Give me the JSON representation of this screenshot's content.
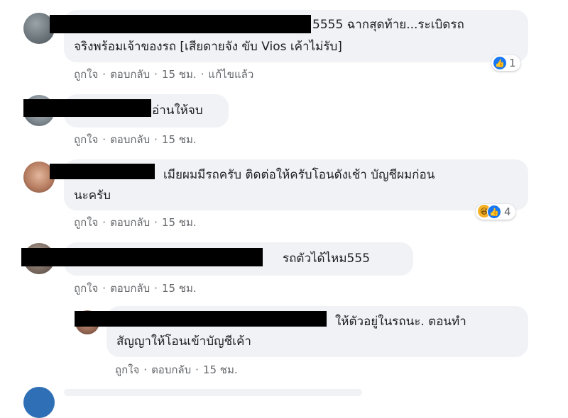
{
  "comments": [
    {
      "line1": "5555 ฉากสุดท้าย...ระเบิดรถ",
      "line2": "จริงพร้อมเจ้าของรถ [เสียดายจัง ขับ Vios เค้าไม่รับ]",
      "actions": {
        "like": "ถูกใจ",
        "reply": "ตอบกลับ",
        "time": "15 ชม.",
        "edited": "แก้ไขแล้ว"
      },
      "reaction_count": "1"
    },
    {
      "line1": "อ่านให้จบ",
      "actions": {
        "like": "ถูกใจ",
        "reply": "ตอบกลับ",
        "time": "15 ชม."
      }
    },
    {
      "line1": "เมียผมมีรถครับ ติดต่อให้ครับโอนดังเช้า บัญชีผมก่อน",
      "line2": "นะครับ",
      "actions": {
        "like": "ถูกใจ",
        "reply": "ตอบกลับ",
        "time": "15 ชม."
      },
      "reaction_count": "4"
    },
    {
      "line1": "รถตัวได้ไหม555",
      "actions": {
        "like": "ถูกใจ",
        "reply": "ตอบกลับ",
        "time": "15 ชม."
      }
    },
    {
      "line1": "ให้ตัวอยู่ในรถนะ. ตอนทำ",
      "line2": "สัญญาให้โอนเข้าบัญชีเค้า",
      "actions": {
        "like": "ถูกใจ",
        "reply": "ตอบกลับ",
        "time": "15 ชม."
      }
    }
  ],
  "separator": "·",
  "icons": {
    "like": "thumbs-up-icon",
    "haha": "laughing-face-icon"
  },
  "colors": {
    "bubble": "#f0f2f5",
    "meta": "#65676b",
    "like_blue": "#1877f2"
  }
}
